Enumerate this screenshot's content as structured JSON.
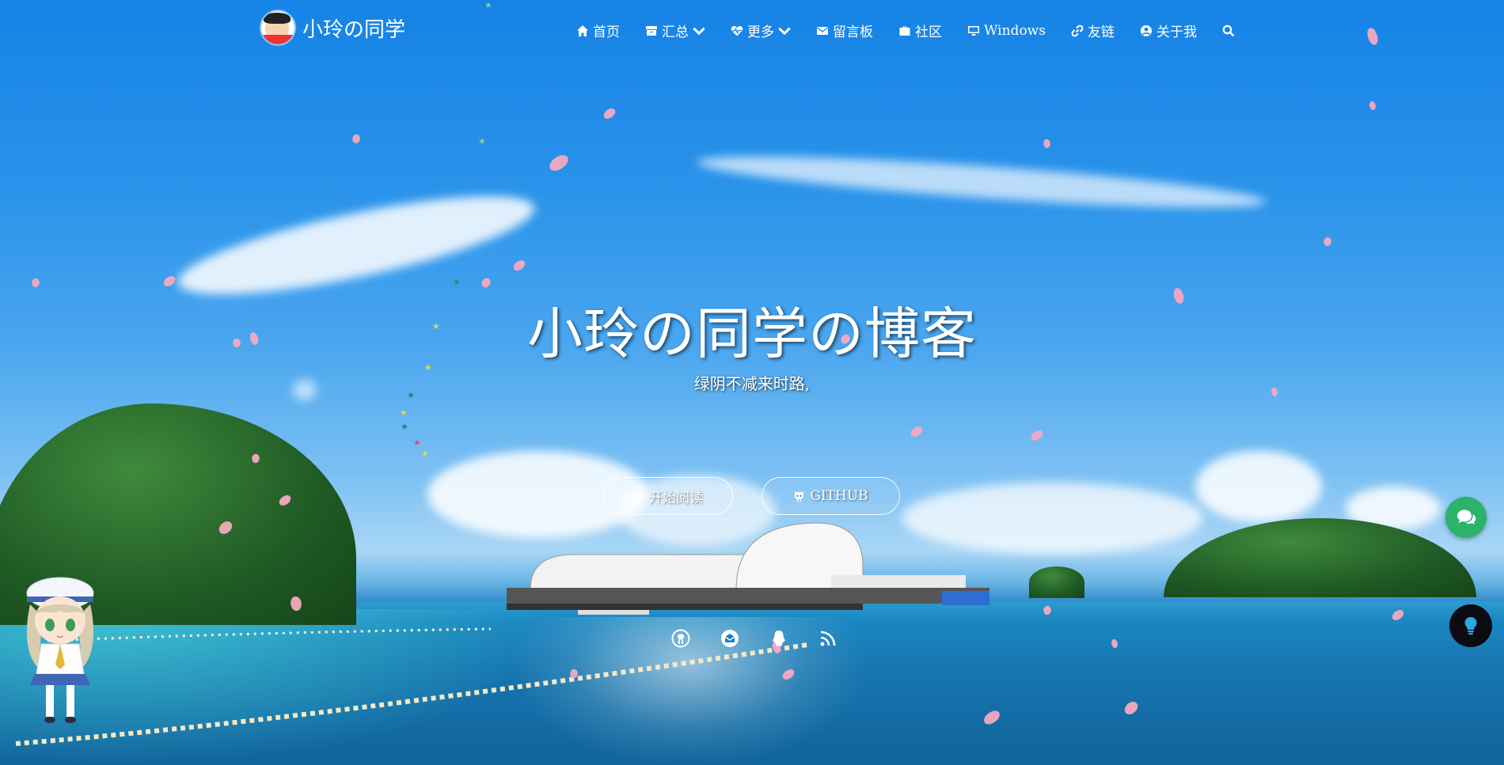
{
  "brand": {
    "name": "小玲の同学"
  },
  "nav": {
    "items": [
      {
        "label": "首页",
        "icon": "home-icon"
      },
      {
        "label": "汇总",
        "icon": "archive-icon",
        "dropdown": true
      },
      {
        "label": "更多",
        "icon": "heartbeat-icon",
        "dropdown": true
      },
      {
        "label": "留言板",
        "icon": "envelope-icon"
      },
      {
        "label": "社区",
        "icon": "briefcase-icon"
      },
      {
        "label": "Windows",
        "icon": "desktop-icon"
      },
      {
        "label": "友链",
        "icon": "link-icon"
      },
      {
        "label": "关于我",
        "icon": "user-circle-icon"
      }
    ],
    "search_icon": "search-icon"
  },
  "hero": {
    "title": "小玲の同学の博客",
    "subtitle": "绿阴不减来时路,"
  },
  "buttons": {
    "read": "开始阅读",
    "github": "GITHUB"
  },
  "social_icons": [
    "github-icon",
    "mail-icon",
    "qq-icon",
    "rss-icon"
  ],
  "floating": {
    "chat_icon": "comments-icon",
    "theme_icon": "lightbulb-icon"
  },
  "colors": {
    "accent_green": "#2bb36a",
    "petal_pink": "#f6a9c0",
    "dark_button": "#0b0b12"
  }
}
